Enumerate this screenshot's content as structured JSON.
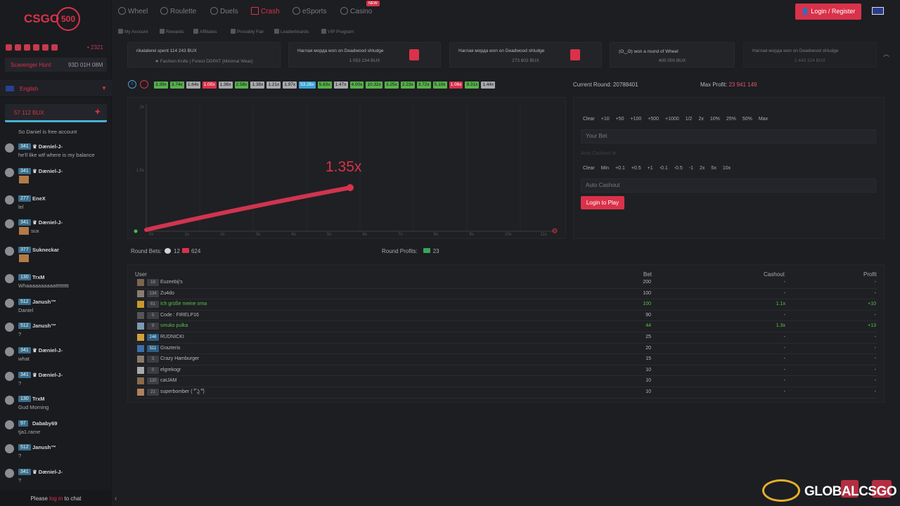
{
  "brand": {
    "name": "CSGO",
    "num": "500"
  },
  "sidebar": {
    "online": "• 2321",
    "scavenger": {
      "label": "Scavenger Hunt",
      "timer": "93D 01H 08M"
    },
    "language": "English",
    "balance": "57 112 BUX",
    "system_msg": "So Daniel is free account",
    "messages": [
      {
        "lvl": "341",
        "name": "♛ Dæniel-J-",
        "text": "he'll like wtf where is my balance",
        "img": false
      },
      {
        "lvl": "341",
        "name": "♛ Dæniel-J-",
        "text": "",
        "img": true
      },
      {
        "lvl": "277",
        "name": "EneX",
        "text": "lel",
        "img": false
      },
      {
        "lvl": "341",
        "name": "♛ Dæniel-J-",
        "text": "sux",
        "img": true
      },
      {
        "lvl": "377",
        "name": "Sukneckar",
        "text": "",
        "img": true
      },
      {
        "lvl": "130",
        "name": "TrxM",
        "text": "Whaaaaaaaaaattttttttt",
        "img": false
      },
      {
        "lvl": "512",
        "name": "Janush™",
        "text": "Daniel",
        "img": false
      },
      {
        "lvl": "512",
        "name": "Janush™",
        "text": "?",
        "img": false
      },
      {
        "lvl": "341",
        "name": "♛ Dæniel-J-",
        "text": "what",
        "img": false
      },
      {
        "lvl": "341",
        "name": "♛ Dæniel-J-",
        "text": "?",
        "img": false
      },
      {
        "lvl": "130",
        "name": "TrxM",
        "text": "Gud Morning",
        "img": false
      },
      {
        "lvl": "97",
        "name": "Dababy69",
        "text": "tja1.rame",
        "img": false
      },
      {
        "lvl": "512",
        "name": "Janush™",
        "text": "?",
        "img": false
      },
      {
        "lvl": "341",
        "name": "♛ Dæniel-J-",
        "text": "?",
        "img": false
      }
    ],
    "chat_foot": {
      "pre": "Please ",
      "link": "log in",
      "post": " to chat"
    }
  },
  "nav": {
    "items": [
      "Wheel",
      "Roulette",
      "Duels",
      "Crash",
      "eSports",
      "Casino"
    ],
    "new_badge": "NEW",
    "sub": [
      "My Account",
      "Rewards",
      "Affiliates",
      "Provably Fair",
      "Leaderboards",
      "VIP Program"
    ],
    "login": "Login / Register"
  },
  "feed": [
    {
      "l1": "rikatalerei spent 114 243 BUX",
      "l2": "★ Fashion Knife | Forest DDPAT (Minimal Wear)"
    },
    {
      "l1": "Наглая морда won on Deadwood shludge",
      "l2": "1 053 234 BUX"
    },
    {
      "l1": "Наглая морда won on Deadwood shludge",
      "l2": "273 802 BUX"
    },
    {
      "l1": "(ʘ‿ʘ) won a round of Wheel",
      "l2": "400 000 BUX"
    },
    {
      "l1": "Наглая морда won on Deadwood shludge",
      "l2": "1 443 324 BUX"
    }
  ],
  "history": [
    {
      "v": "3.39x",
      "c": "g"
    },
    {
      "v": "3.74x",
      "c": "g"
    },
    {
      "v": "1.64x",
      "c": "w"
    },
    {
      "v": "1.00x",
      "c": "r"
    },
    {
      "v": "1.36x",
      "c": "w"
    },
    {
      "v": "2.58x",
      "c": "g"
    },
    {
      "v": "1.38x",
      "c": "w"
    },
    {
      "v": "1.21x",
      "c": "w"
    },
    {
      "v": "1.97x",
      "c": "w"
    },
    {
      "v": "53.26x",
      "c": "b"
    },
    {
      "v": "5.83x",
      "c": "g"
    },
    {
      "v": "1.47x",
      "c": "w"
    },
    {
      "v": "4.00x",
      "c": "g"
    },
    {
      "v": "10.32x",
      "c": "g"
    },
    {
      "v": "3.25x",
      "c": "g"
    },
    {
      "v": "2.23x",
      "c": "g"
    },
    {
      "v": "3.72x",
      "c": "g"
    },
    {
      "v": "5.10x",
      "c": "g"
    },
    {
      "v": "1.06x",
      "c": "r"
    },
    {
      "v": "9.31x",
      "c": "g"
    },
    {
      "v": "1.44x",
      "c": "w"
    }
  ],
  "round": {
    "label": "Current Round: ",
    "value": "20788401"
  },
  "max_profit": {
    "label": "Max Profit: ",
    "value": "23 941 149"
  },
  "chart": {
    "multiplier": "1.35x",
    "y_ticks": [
      "2x",
      "1.5x"
    ],
    "x_ticks": [
      "0s",
      "1s",
      "2s",
      "3s",
      "4s",
      "5s",
      "6s",
      "7s",
      "8s",
      "9s",
      "10s",
      "11s"
    ],
    "progress": [
      0,
      0.5
    ]
  },
  "bet_panel": {
    "chips1": [
      "Clear",
      "+10",
      "+50",
      "+100",
      "+500",
      "+1000",
      "1/2",
      "2x",
      "10%",
      "25%",
      "50%",
      "Max"
    ],
    "your_bet": "Your Bet",
    "auto_label": "Auto Cashout at",
    "chips2": [
      "Clear",
      "Min",
      "+0.1",
      "+0.5",
      "+1",
      "-0.1",
      "-0.5",
      "-1",
      "2x",
      "5x",
      "10x"
    ],
    "auto_cashout": "Auto Cashout",
    "login_to_play": "Login to Play"
  },
  "round_bets": {
    "label": "Round Bets:",
    "users": "12",
    "amount": "624"
  },
  "round_profits": {
    "label": "Round Profits:",
    "amount": "23"
  },
  "table": {
    "headers": [
      "User",
      "Bet",
      "Cashout",
      "Profit"
    ],
    "rows": [
      {
        "lvl": "18",
        "name": "Euzeebij's",
        "bet": "200",
        "cashout": "-",
        "profit": "-",
        "win": false
      },
      {
        "lvl": "134",
        "name": "Zu4do",
        "bet": "100",
        "cashout": "-",
        "profit": "-",
        "win": false
      },
      {
        "lvl": "61",
        "name": "Ich grüße meine oma",
        "bet": "100",
        "cashout": "1.1x",
        "profit": "+10",
        "win": true
      },
      {
        "lvl": "5",
        "name": "Code : FIRELP16",
        "bet": "90",
        "cashout": "-",
        "profit": "-",
        "win": false
      },
      {
        "lvl": "9",
        "name": "smuko pulka",
        "bet": "44",
        "cashout": "1.3x",
        "profit": "+13",
        "win": true
      },
      {
        "lvl": "246",
        "name": "RUDNICKI",
        "bet": "25",
        "cashout": "-",
        "profit": "-",
        "win": false
      },
      {
        "lvl": "511",
        "name": "Grazteris",
        "bet": "20",
        "cashout": "-",
        "profit": "-",
        "win": false
      },
      {
        "lvl": "3",
        "name": "Crazy Hamburger",
        "bet": "15",
        "cashout": "-",
        "profit": "-",
        "win": false
      },
      {
        "lvl": "0",
        "name": "elgrekogr",
        "bet": "10",
        "cashout": "-",
        "profit": "-",
        "win": false
      },
      {
        "lvl": "120",
        "name": "catJAM",
        "bet": "10",
        "cashout": "-",
        "profit": "-",
        "win": false
      },
      {
        "lvl": "21",
        "name": "superbomber ( ͡° ͜ʖ ͡°)",
        "bet": "10",
        "cashout": "-",
        "profit": "-",
        "win": false
      }
    ]
  },
  "watermark": "GLOBALCSGO"
}
